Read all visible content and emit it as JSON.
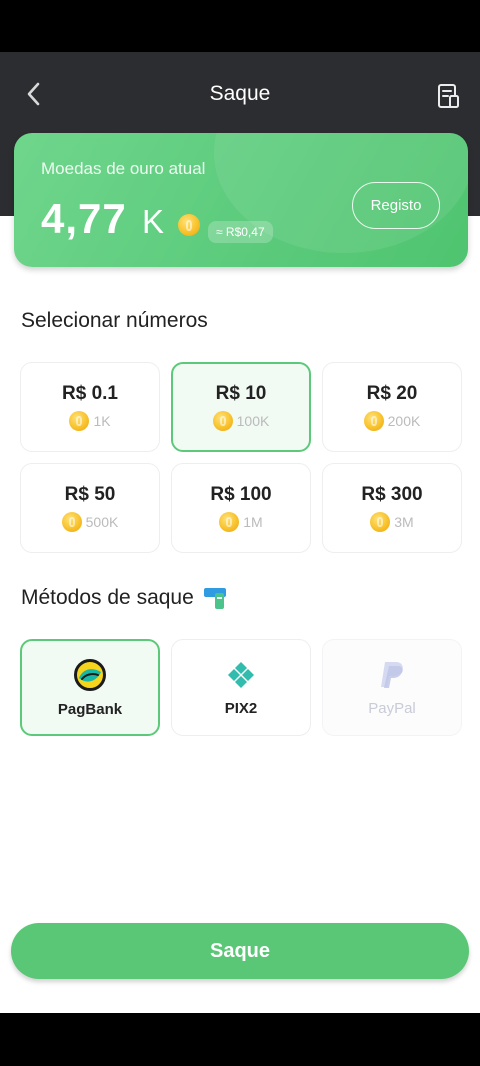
{
  "header": {
    "title": "Saque"
  },
  "balance": {
    "label": "Moedas de ouro atual",
    "value": "4,77",
    "unit": "K",
    "brl": "≈ R$0,47",
    "registo_label": "Registo"
  },
  "amounts": {
    "title": "Selecionar números",
    "items": [
      {
        "value": "R$ 0.1",
        "coins": "1K",
        "selected": false
      },
      {
        "value": "R$ 10",
        "coins": "100K",
        "selected": true
      },
      {
        "value": "R$ 20",
        "coins": "200K",
        "selected": false
      },
      {
        "value": "R$ 50",
        "coins": "500K",
        "selected": false
      },
      {
        "value": "R$ 100",
        "coins": "1M",
        "selected": false
      },
      {
        "value": "R$ 300",
        "coins": "3M",
        "selected": false
      }
    ]
  },
  "methods": {
    "title": "Métodos de saque",
    "items": [
      {
        "label": "PagBank",
        "icon": "pagbank-icon",
        "selected": true,
        "enabled": true
      },
      {
        "label": "PIX2",
        "icon": "pix-icon",
        "selected": false,
        "enabled": true
      },
      {
        "label": "PayPal",
        "icon": "paypal-icon",
        "selected": false,
        "enabled": false
      }
    ]
  },
  "submit": {
    "label": "Saque"
  },
  "colors": {
    "accent": "#5ac776",
    "header_bg": "#2c2d30",
    "coin": "#f8c22c"
  }
}
